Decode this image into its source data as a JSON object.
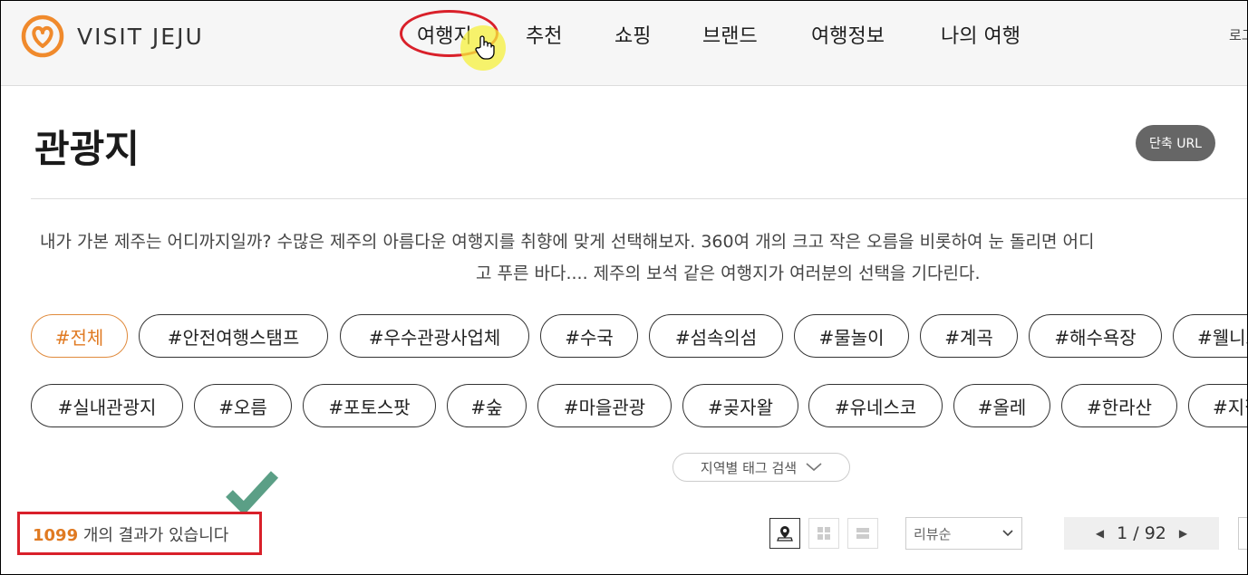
{
  "header": {
    "logo_text": "VISIT JEJU",
    "nav": [
      "여행지",
      "추천",
      "쇼핑",
      "브랜드",
      "여행정보",
      "나의 여행"
    ],
    "login": "로그"
  },
  "page": {
    "title": "관광지",
    "short_url_label": "단축 URL",
    "description_line1": "내가 가본 제주는 어디까지일까? 수많은 제주의 아름다운 여행지를 취향에 맞게 선택해보자. 360여 개의 크고 작은 오름을 비롯하여 눈 돌리면 어디",
    "description_line2": "고 푸른 바다.... 제주의 보석 같은 여행지가 여러분의 선택을 기다린다."
  },
  "tags_row1": [
    "#전체",
    "#안전여행스탬프",
    "#우수관광사업체",
    "#수국",
    "#섬속의섬",
    "#물놀이",
    "#계곡",
    "#해수욕장",
    "#웰니스"
  ],
  "tags_row2": [
    "#실내관광지",
    "#오름",
    "#포토스팟",
    "#숲",
    "#마을관광",
    "#곶자왈",
    "#유네스코",
    "#올레",
    "#한라산",
    "#지질"
  ],
  "region_search_label": "지역별 태그 검색",
  "results": {
    "count": "1099",
    "suffix": " 개의 결과가 있습니다"
  },
  "sort": {
    "selected": "리뷰순"
  },
  "pagination": {
    "current": "1",
    "total": "92",
    "separator": " / "
  },
  "colors": {
    "accent": "#e07a22",
    "annotation_red": "#d9202a",
    "check_green": "#5b9f86"
  }
}
